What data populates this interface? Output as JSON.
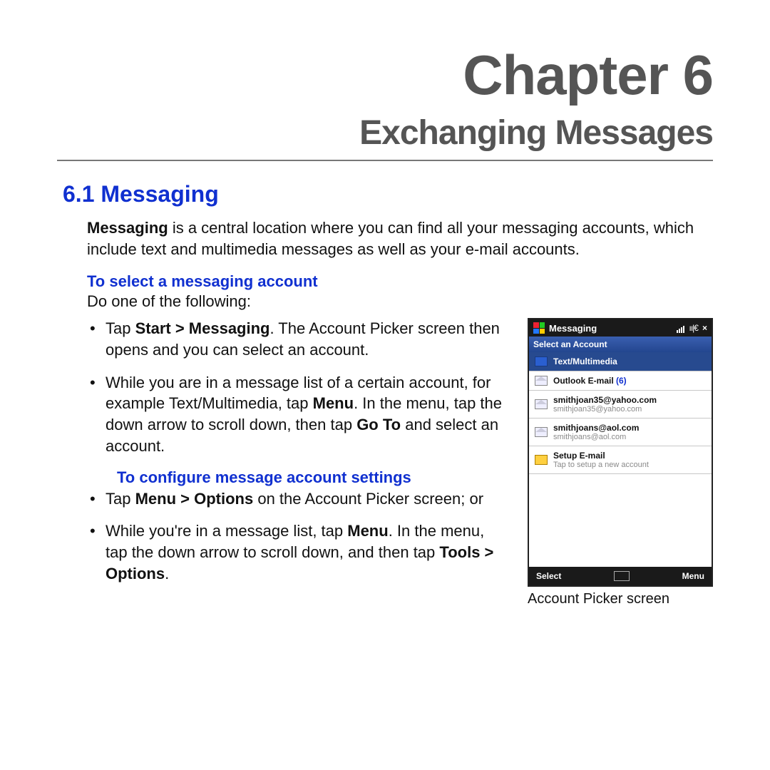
{
  "chapter": {
    "title": "Chapter 6",
    "subtitle": "Exchanging Messages"
  },
  "section": {
    "number_title": "6.1  Messaging"
  },
  "intro": {
    "lead_bold": "Messaging",
    "rest": " is a central location where you can find all your messaging accounts, which include text and multimedia messages as well as your e-mail accounts."
  },
  "select": {
    "heading": "To select a messaging account",
    "lead": "Do one of the following:",
    "items": [
      {
        "pre": "Tap ",
        "b1": "Start > Messaging",
        "post": ". The Account Picker screen then opens and you can select an account."
      },
      {
        "pre": "While you are in a message list of a certain account, for example Text/Multimedia, tap ",
        "b1": "Menu",
        "mid": ". In the menu, tap the down arrow to scroll down, then tap ",
        "b2": "Go To",
        "post": " and select an account."
      }
    ]
  },
  "configure": {
    "heading": "To configure message account settings",
    "items": [
      {
        "pre": "Tap ",
        "b1": "Menu > Options",
        "post": " on the Account Picker screen; or"
      },
      {
        "pre": "While you're in a message list, tap ",
        "b1": "Menu",
        "mid": ". In the menu, tap the down arrow to scroll down, and then tap ",
        "b2": "Tools > Options",
        "post": "."
      }
    ]
  },
  "phone": {
    "titlebar": "Messaging",
    "close": "×",
    "header": "Select an Account",
    "rows": [
      {
        "name": "Text/Multimedia",
        "sub": "",
        "icon": "phone-icon",
        "selected": true
      },
      {
        "name": "Outlook E-mail ",
        "count": "(6)",
        "sub": "",
        "icon": "envelope-icon"
      },
      {
        "name": "smithjoan35@yahoo.com",
        "sub": "smithjoan35@yahoo.com",
        "icon": "envelope-icon"
      },
      {
        "name": "smithjoans@aol.com",
        "sub": "smithjoans@aol.com",
        "icon": "envelope-icon"
      },
      {
        "name": "Setup E-mail",
        "sub": "Tap to setup a new account",
        "icon": "setup-icon"
      }
    ],
    "softkeys": {
      "left": "Select",
      "right": "Menu"
    },
    "caption": "Account Picker screen"
  }
}
